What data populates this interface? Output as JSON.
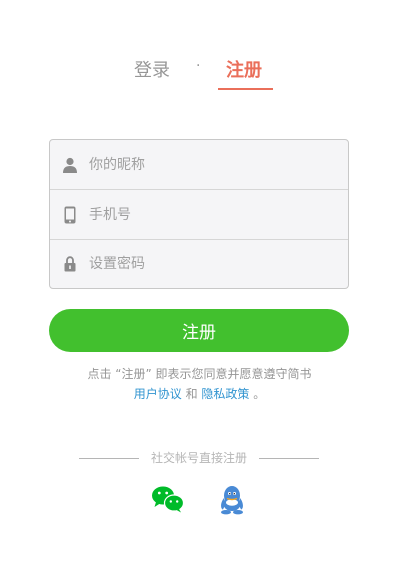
{
  "tabs": {
    "login": "登录",
    "separator": "·",
    "register": "注册"
  },
  "form": {
    "nickname_placeholder": "你的昵称",
    "phone_placeholder": "手机号",
    "password_placeholder": "设置密码"
  },
  "submit_label": "注册",
  "terms": {
    "prefix": "点击 “注册” 即表示您同意并愿意遵守简书",
    "user_agreement": "用户协议",
    "and": "和",
    "privacy_policy": "隐私政策",
    "suffix": "。"
  },
  "social": {
    "title": "社交帐号直接注册",
    "icons": [
      "wechat-icon",
      "qq-icon"
    ]
  },
  "colors": {
    "accent": "#ea6f5a",
    "button": "#42c02e",
    "link": "#3194d0",
    "wechat": "#00bb29",
    "qq": "#498ad5"
  }
}
